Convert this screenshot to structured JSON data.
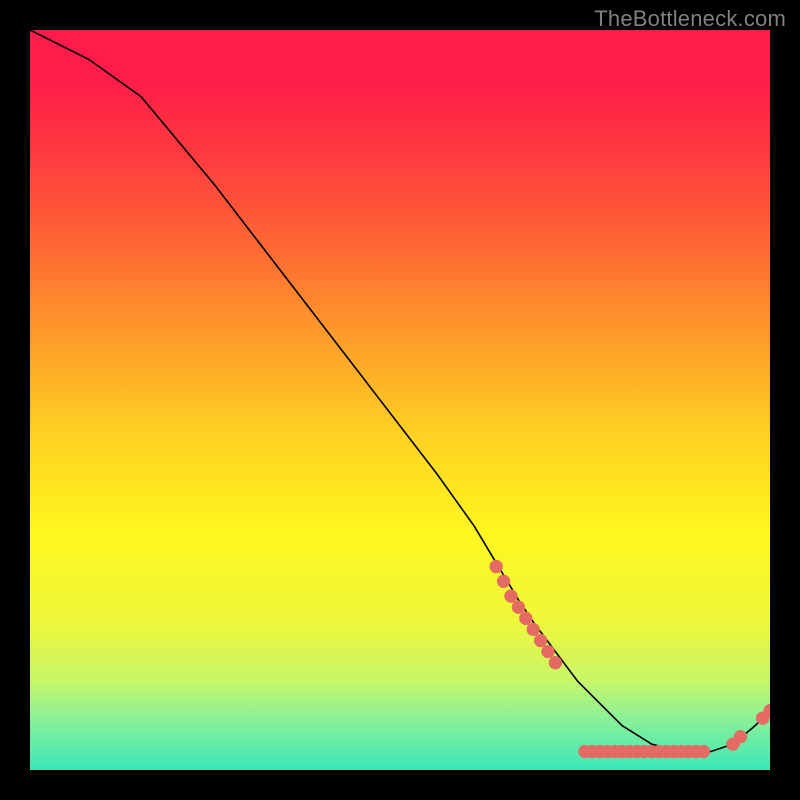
{
  "attribution": "TheBottleneck.com",
  "chart_data": {
    "type": "line",
    "title": "",
    "xlabel": "",
    "ylabel": "",
    "xlim": [
      0,
      100
    ],
    "ylim": [
      0,
      100
    ],
    "series": [
      {
        "name": "bottleneck-curve",
        "x": [
          0,
          4,
          8,
          15,
          25,
          35,
          45,
          55,
          60,
          63,
          66,
          68,
          71,
          74,
          77,
          80,
          84,
          88,
          92,
          95,
          98,
          100
        ],
        "y": [
          100,
          98,
          96,
          91,
          79,
          66,
          53,
          40,
          33,
          28,
          23,
          20,
          16,
          12,
          9,
          6,
          3.5,
          2.5,
          2.5,
          3.5,
          6,
          8
        ]
      }
    ],
    "highlight_dots": {
      "name": "highlight-dots",
      "color": "#e46a63",
      "points": [
        [
          63,
          27.5
        ],
        [
          64,
          25.5
        ],
        [
          65,
          23.5
        ],
        [
          66,
          22
        ],
        [
          67,
          20.5
        ],
        [
          68,
          19
        ],
        [
          69,
          17.5
        ],
        [
          70,
          16
        ],
        [
          71,
          14.5
        ],
        [
          75,
          2.5
        ],
        [
          76,
          2.5
        ],
        [
          77,
          2.5
        ],
        [
          78,
          2.5
        ],
        [
          79,
          2.5
        ],
        [
          80,
          2.5
        ],
        [
          81,
          2.5
        ],
        [
          82,
          2.5
        ],
        [
          83,
          2.5
        ],
        [
          84,
          2.5
        ],
        [
          85,
          2.5
        ],
        [
          86,
          2.5
        ],
        [
          87,
          2.5
        ],
        [
          88,
          2.5
        ],
        [
          89,
          2.5
        ],
        [
          90,
          2.5
        ],
        [
          91,
          2.5
        ],
        [
          95,
          3.5
        ],
        [
          96,
          4.5
        ],
        [
          99,
          7
        ],
        [
          100,
          8
        ]
      ]
    },
    "background": "vertical-gradient red→yellow→green"
  }
}
